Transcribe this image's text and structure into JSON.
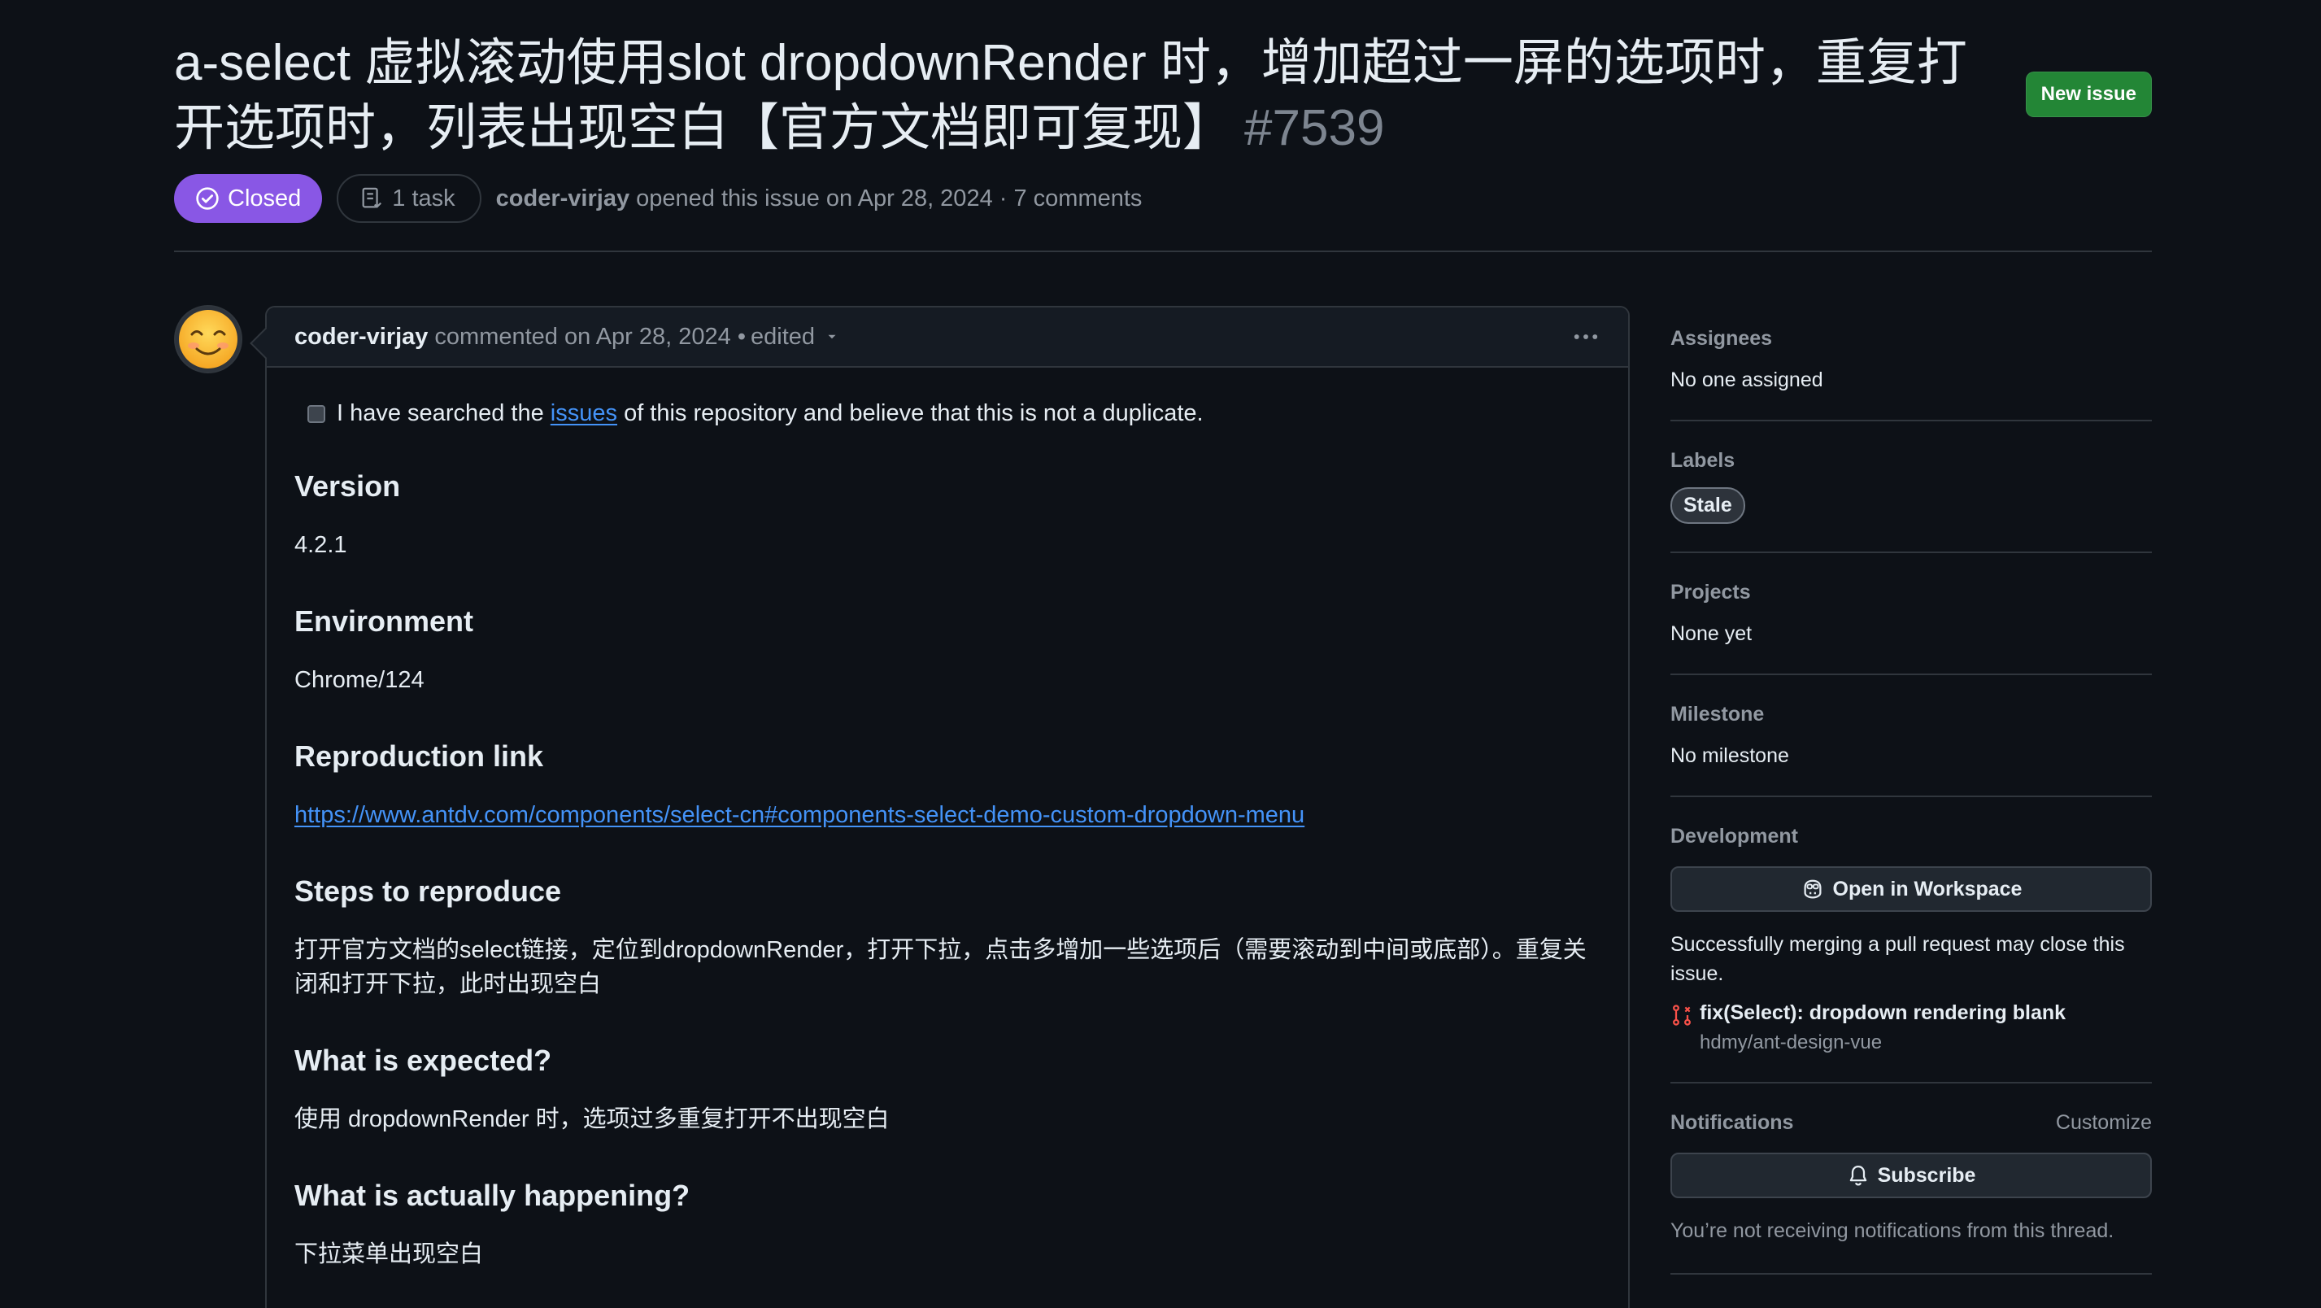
{
  "issue": {
    "title": "a-select 虚拟滚动使用slot dropdownRender 时，增加超过一屏的选项时，重复打开选项时，列表出现空白【官方文档即可复现】",
    "number": "#7539",
    "new_issue_label": "New issue",
    "state": "Closed",
    "tasks": "1 task",
    "author": "coder-virjay",
    "opened_text": "opened this issue on Apr 28, 2024 · 7 comments"
  },
  "comment": {
    "author": "coder-virjay",
    "commented_text": "commented on Apr 28, 2024 •",
    "edited_label": "edited",
    "checkbox_text_before": "I have searched the",
    "checkbox_link": "issues",
    "checkbox_text_after": "of this repository and believe that this is not a duplicate.",
    "sections": [
      {
        "heading": "Version",
        "text": "4.2.1"
      },
      {
        "heading": "Environment",
        "text": "Chrome/124"
      },
      {
        "heading": "Reproduction link",
        "text": "https://www.antdv.com/components/select-cn#components-select-demo-custom-dropdown-menu"
      },
      {
        "heading": "Steps to reproduce",
        "text": "打开官方文档的select链接，定位到dropdownRender，打开下拉，点击多增加一些选项后（需要滚动到中间或底部）。重复关闭和打开下拉，此时出现空白"
      },
      {
        "heading": "What is expected?",
        "text": "使用 dropdownRender 时，选项过多重复打开不出现空白"
      },
      {
        "heading": "What is actually happening?",
        "text": "下拉菜单出现空白"
      }
    ]
  },
  "sidebar": {
    "assignees": {
      "heading": "Assignees",
      "value": "No one assigned"
    },
    "labels": {
      "heading": "Labels",
      "items": [
        "Stale"
      ]
    },
    "projects": {
      "heading": "Projects",
      "value": "None yet"
    },
    "milestone": {
      "heading": "Milestone",
      "value": "No milestone"
    },
    "development": {
      "heading": "Development",
      "button_label": "Open in Workspace",
      "note": "Successfully merging a pull request may close this issue.",
      "pr_title": "fix(Select): dropdown rendering blank",
      "pr_repo": "hdmy/ant-design-vue"
    },
    "notifications": {
      "heading": "Notifications",
      "customize_label": "Customize",
      "button_label": "Subscribe",
      "note": "You’re not receiving notifications from this thread."
    }
  },
  "colors": {
    "background": "#0d1117",
    "closed_badge": "#8957e5",
    "new_issue_button": "#238636",
    "link": "#4493f8"
  },
  "icons": [
    "check-circle-icon",
    "task-list-icon",
    "kebab-horizontal-icon",
    "caret-down-icon",
    "copilot-icon",
    "pull-request-closed-icon",
    "bell-icon",
    "avatar-emoji"
  ]
}
